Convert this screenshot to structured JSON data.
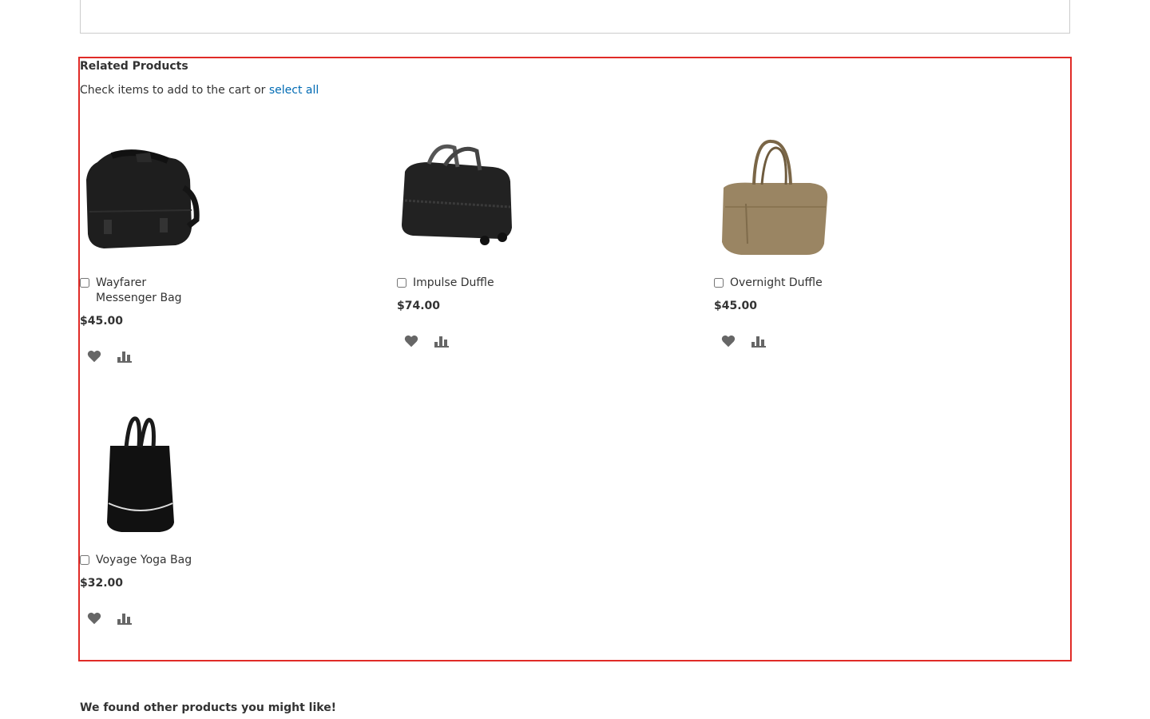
{
  "related": {
    "title": "Related Products",
    "instructions": "Check items to add to the cart or",
    "select_all": "select all",
    "products": [
      {
        "name": "Wayfarer Messenger Bag",
        "name_line1": "Wayfarer",
        "name_line2": "Messenger Bag",
        "price": "$45.00",
        "color": "#1e1e1e"
      },
      {
        "name": "Impulse Duffle",
        "price": "$74.00",
        "color": "#222222"
      },
      {
        "name": "Overnight Duffle",
        "price": "$45.00",
        "color": "#9a8563"
      },
      {
        "name": "Voyage Yoga Bag",
        "price": "$32.00",
        "color": "#111111"
      }
    ]
  },
  "other": {
    "title": "We found other products you might like!"
  },
  "colors": {
    "highlight_border": "#e02b27",
    "link": "#006bb4",
    "icon": "#666666"
  }
}
